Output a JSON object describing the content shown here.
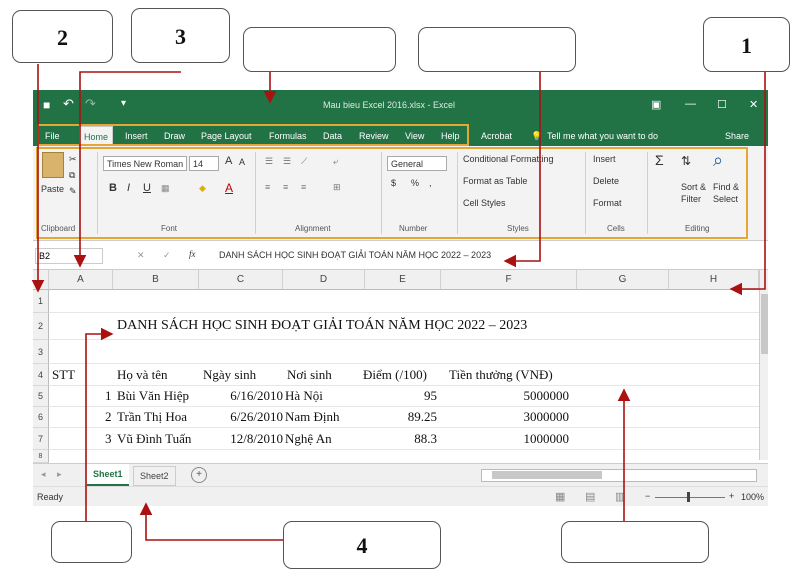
{
  "callouts": {
    "c1": "1",
    "c2": "2",
    "c3": "3",
    "c4": "4",
    "c5": "",
    "c6": "",
    "c7": "",
    "c8": ""
  },
  "window": {
    "title": "Mau bieu Excel 2016.xlsx - Excel",
    "quick_access": {
      "save": "■",
      "undo": "↶",
      "redo": "↷",
      "customize": "▾"
    },
    "controls": {
      "ribbon_options": "▣",
      "minimize": "—",
      "maximize": "☐",
      "close": "✕"
    }
  },
  "tabs": [
    "File",
    "Home",
    "Insert",
    "Draw",
    "Page Layout",
    "Formulas",
    "Data",
    "Review",
    "View",
    "Help",
    "Acrobat"
  ],
  "tell_me": "Tell me what you want to do",
  "share": "Share",
  "ribbon": {
    "clipboard": {
      "paste": "Paste",
      "label": "Clipboard"
    },
    "font": {
      "name": "Times New Roman",
      "size": "14",
      "grow": "A",
      "shrink": "A",
      "bold": "B",
      "italic": "I",
      "underline": "U",
      "font_color": "A",
      "label": "Font"
    },
    "alignment": {
      "label": "Alignment"
    },
    "number": {
      "format": "General",
      "label": "Number",
      "currency": "$",
      "percent": "%",
      "comma": ","
    },
    "styles": {
      "conditional": "Conditional Formatting",
      "format_table": "Format as Table",
      "cell_styles": "Cell Styles",
      "label": "Styles"
    },
    "cells": {
      "insert": "Insert",
      "delete": "Delete",
      "format": "Format",
      "label": "Cells"
    },
    "editing": {
      "sum": "Σ",
      "sort_line1": "Sort &",
      "sort_line2": "Filter",
      "find_line1": "Find &",
      "find_line2": "Select",
      "label": "Editing"
    }
  },
  "formula_bar": {
    "name_box": "B2",
    "fx": "fx",
    "cancel": "✕",
    "enter": "✓",
    "formula": "DANH SÁCH HỌC SINH ĐOẠT GIẢI TOÁN NĂM HỌC 2022 – 2023"
  },
  "columns": [
    "A",
    "B",
    "C",
    "D",
    "E",
    "F",
    "G",
    "H"
  ],
  "rows": [
    "1",
    "2",
    "3",
    "4",
    "5",
    "6",
    "7",
    "8"
  ],
  "sheet": {
    "title": "DANH SÁCH HỌC SINH ĐOẠT GIẢI TOÁN NĂM HỌC 2022 – 2023",
    "headers": {
      "stt": "STT",
      "name": "Họ và tên",
      "dob": "Ngày sinh",
      "pob": "Nơi sinh",
      "score": "Điểm (/100)",
      "prize": "Tiền thưởng (VNĐ)"
    },
    "data": [
      {
        "no": "1",
        "name": "Bùi Văn Hiệp",
        "dob": "6/16/2010",
        "pob": "Hà Nội",
        "score": "95",
        "prize": "5000000"
      },
      {
        "no": "2",
        "name": "Trần Thị Hoa",
        "dob": "6/26/2010",
        "pob": "Nam Định",
        "score": "89.25",
        "prize": "3000000"
      },
      {
        "no": "3",
        "name": "Vũ Đình Tuấn",
        "dob": "12/8/2010",
        "pob": "Nghệ An",
        "score": "88.3",
        "prize": "1000000"
      }
    ]
  },
  "sheet_tabs": [
    "Sheet1",
    "Sheet2"
  ],
  "add_sheet": "+",
  "status": {
    "ready": "Ready",
    "zoom": "100%",
    "zoom_out": "−",
    "zoom_in": "+"
  }
}
